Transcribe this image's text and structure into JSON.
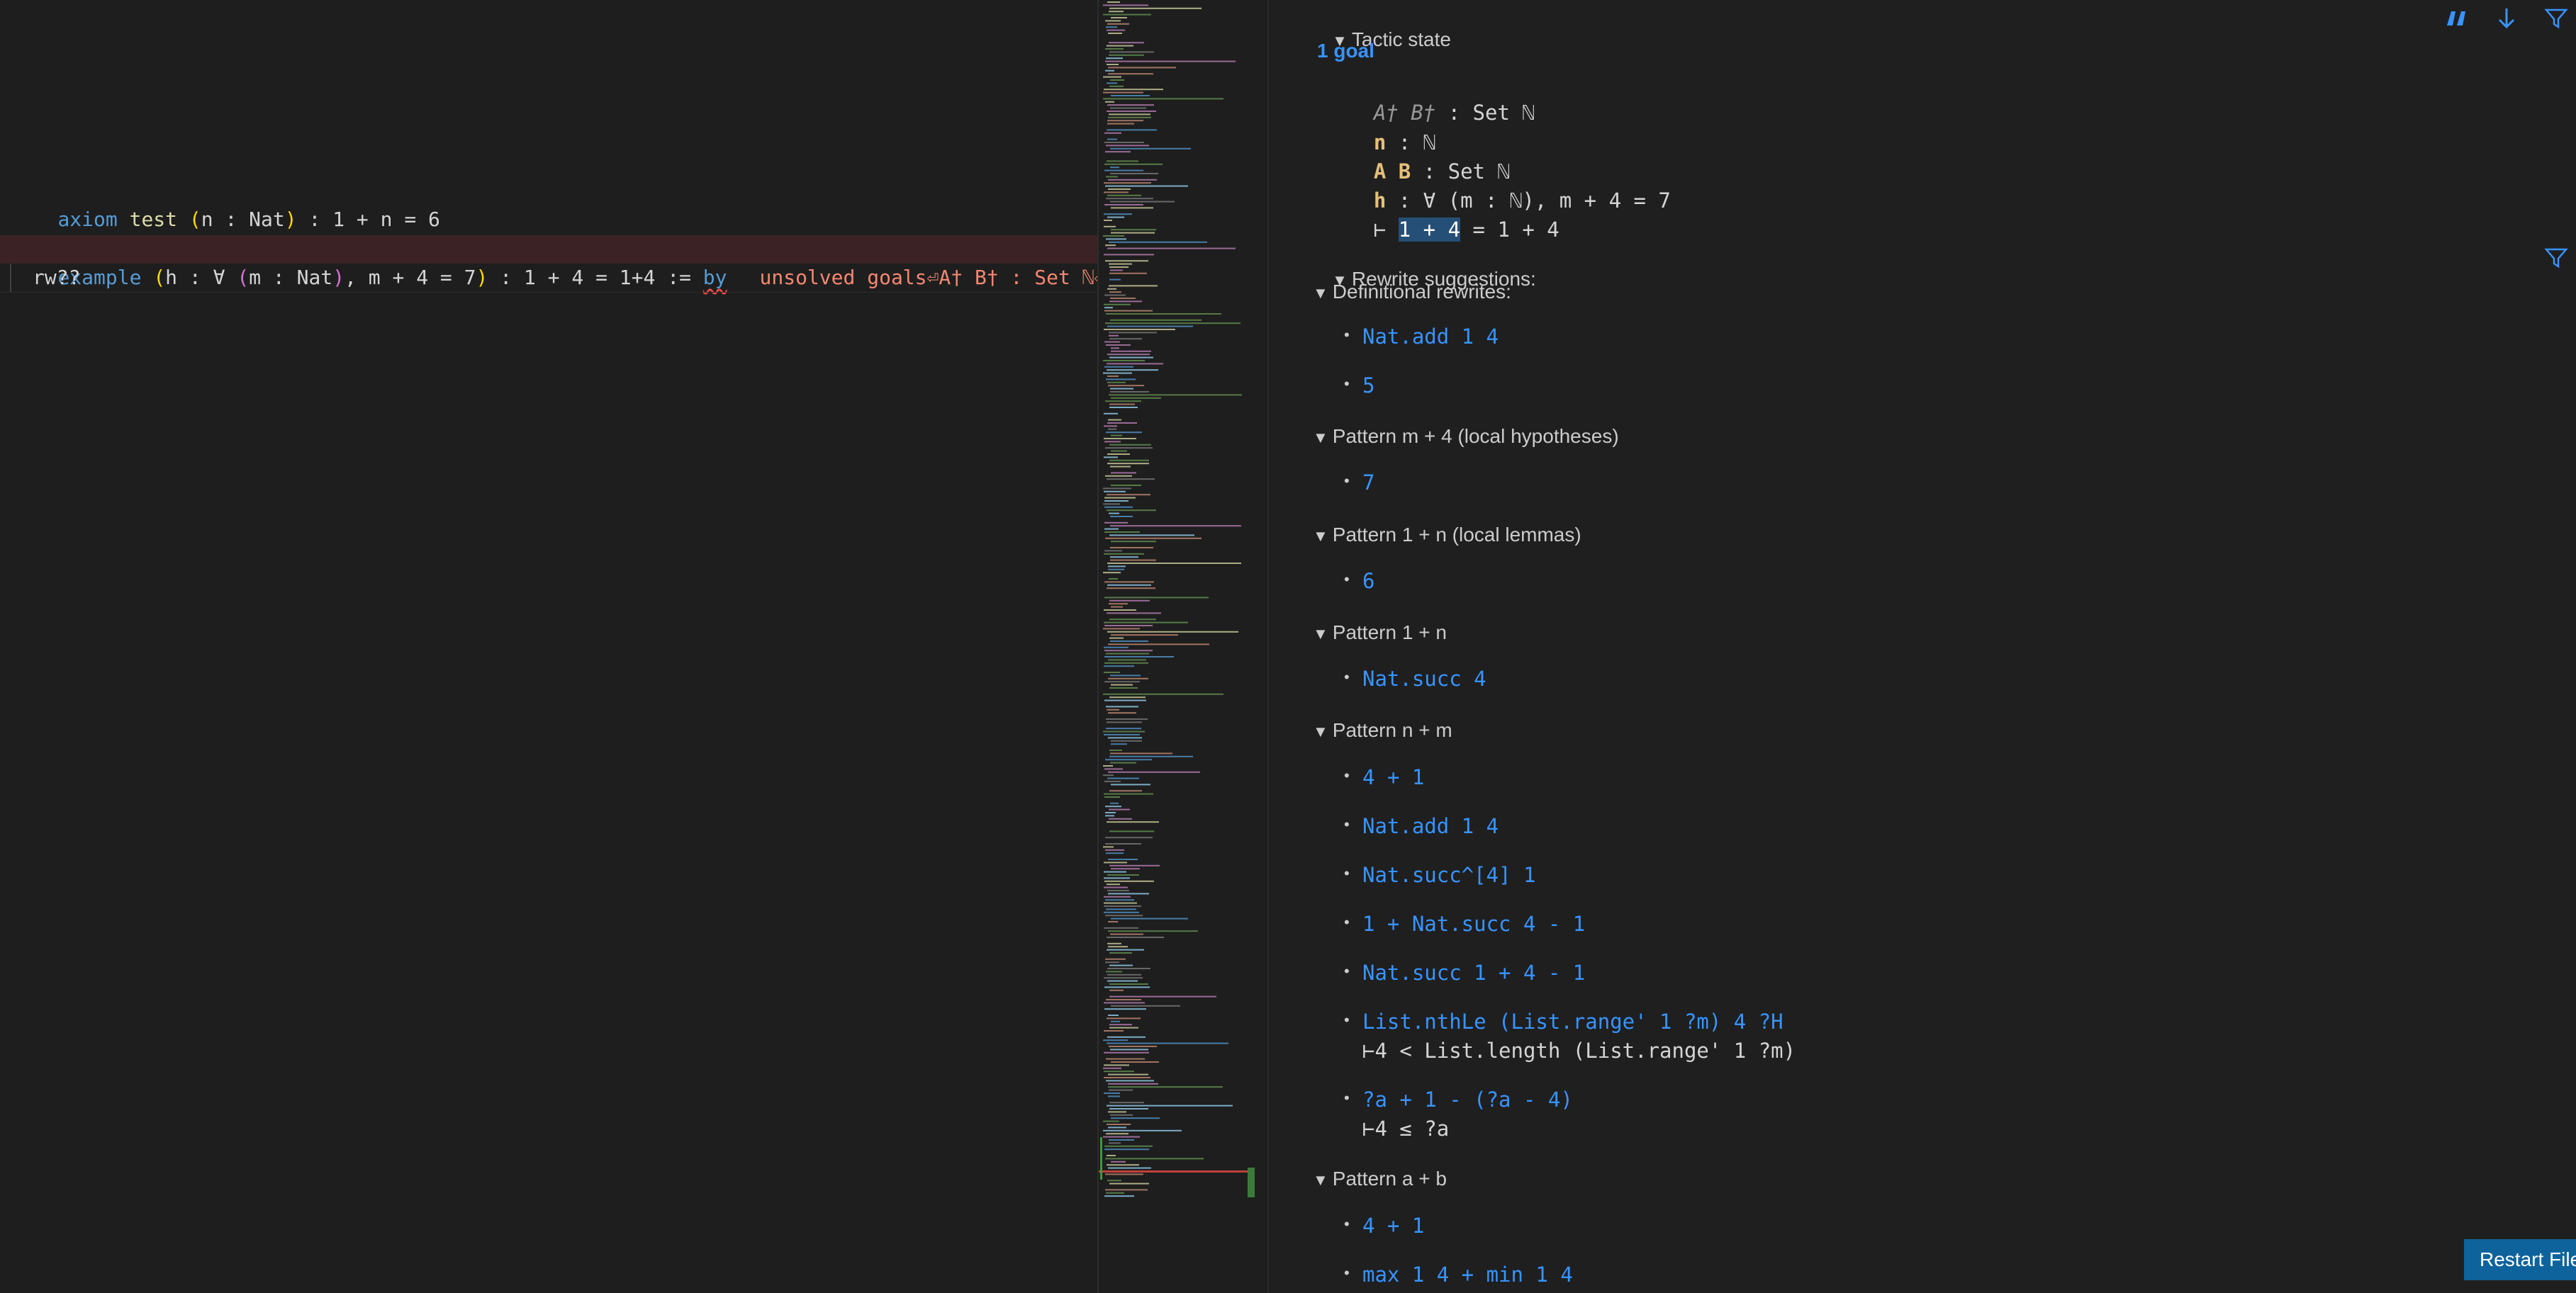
{
  "editor": {
    "axiom_line": {
      "kw": "axiom",
      "name": "test",
      "binder_open": "(",
      "binder_body": "n : Nat",
      "binder_close": ")",
      "rest": " : 1 + n = 6"
    },
    "example_line": {
      "kw": "example",
      "p1": "(",
      "h": "h : ∀ ",
      "p2": "(",
      "m": "m : Nat",
      "p3": ")",
      "rest1": ", m + 4 = 7",
      "p4": ")",
      "rest2": " : 1 + 4 = 1+4 := ",
      "by": "by",
      "error": "unsolved goals⏎A† B† : Set ℕ⏎n"
    },
    "rw_line": "rw??"
  },
  "infoview": {
    "tactic_state_label": "Tactic state",
    "goal_count": "1 goal",
    "hypotheses": [
      {
        "names": "A† B†",
        "type": " : Set ℕ",
        "inaccessible": true
      },
      {
        "names": "n",
        "type": " : ℕ",
        "inaccessible": false
      },
      {
        "names": "A B",
        "type": " : Set ℕ",
        "inaccessible": false
      },
      {
        "names": "h",
        "type": " : ∀ (m : ℕ), m + 4 = 7",
        "inaccessible": false
      }
    ],
    "goal": {
      "turnstile": "⊢ ",
      "selected": "1 + 4",
      "rest": " = 1 + 4"
    },
    "rewrite_label": "Rewrite suggestions:",
    "groups": [
      {
        "title": "Definitional rewrites:",
        "items": [
          {
            "text": "Nat.add 1 4"
          },
          {
            "text": "5"
          }
        ]
      },
      {
        "title": "Pattern m + 4 (local hypotheses)",
        "items": [
          {
            "text": "7"
          }
        ]
      },
      {
        "title": "Pattern 1 + n (local lemmas)",
        "items": [
          {
            "text": "6"
          }
        ]
      },
      {
        "title": "Pattern 1 + n",
        "items": [
          {
            "text": "Nat.succ 4"
          }
        ]
      },
      {
        "title": "Pattern n + m",
        "items": [
          {
            "text": "4 + 1"
          },
          {
            "text": "Nat.add 1 4"
          },
          {
            "text": "Nat.succ^[4] 1"
          },
          {
            "text": "1 + Nat.succ 4 - 1"
          },
          {
            "text": "Nat.succ 1 + 4 - 1"
          },
          {
            "text": "List.nthLe (List.range' 1 ?m) 4 ?H",
            "side": "⊢4 < List.length (List.range' 1 ?m)"
          },
          {
            "text": "?a + 1 - (?a - 4)",
            "side": "⊢4 ≤ ?a"
          }
        ]
      },
      {
        "title": "Pattern a + b",
        "items": [
          {
            "text": "4 + 1"
          },
          {
            "text": "max 1 4 + min 1 4"
          }
        ]
      }
    ],
    "restart_button": "Restart File",
    "icons": [
      "quote-icon",
      "arrow-down-icon",
      "filter-icon"
    ],
    "colors": {
      "link": "#3794ff",
      "hyp_name": "#e5c07b",
      "error": "#f48771",
      "selection": "#264f78",
      "button": "#0e639c"
    }
  }
}
